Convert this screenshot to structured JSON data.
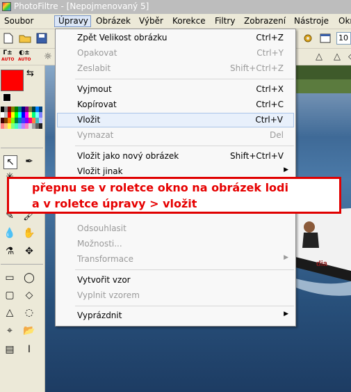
{
  "window": {
    "title": "PhotoFiltre - [Nepojmenovaný 5]"
  },
  "menubar": {
    "items": [
      {
        "label": "Soubor"
      },
      {
        "label": "Úpravy"
      },
      {
        "label": "Obrázek"
      },
      {
        "label": "Výběr"
      },
      {
        "label": "Korekce"
      },
      {
        "label": "Filtry"
      },
      {
        "label": "Zobrazení"
      },
      {
        "label": "Nástroje"
      },
      {
        "label": "Okr"
      }
    ]
  },
  "toolbar": {
    "zoom_value": "10",
    "auto1": "AUTO",
    "auto2": "AUTO"
  },
  "edit_menu": {
    "items": [
      {
        "label": "Zpět Velikost obrázku",
        "shortcut": "Ctrl+Z",
        "enabled": true
      },
      {
        "label": "Opakovat",
        "shortcut": "Ctrl+Y",
        "enabled": false
      },
      {
        "label": "Zeslabit",
        "shortcut": "Shift+Ctrl+Z",
        "enabled": false
      },
      {
        "label": "Vyjmout",
        "shortcut": "Ctrl+X",
        "enabled": true
      },
      {
        "label": "Kopírovat",
        "shortcut": "Ctrl+C",
        "enabled": true
      },
      {
        "label": "Vložit",
        "shortcut": "Ctrl+V",
        "enabled": true,
        "highlighted": true
      },
      {
        "label": "Vymazat",
        "shortcut": "Del",
        "enabled": false
      },
      {
        "label": "Vložit jako nový obrázek",
        "shortcut": "Shift+Ctrl+V",
        "enabled": true
      },
      {
        "label": "Vložit jinak",
        "shortcut": "",
        "enabled": true,
        "submenu": true
      },
      {
        "label": "Odsouhlasit",
        "shortcut": "",
        "enabled": false
      },
      {
        "label": "Možnosti...",
        "shortcut": "",
        "enabled": false
      },
      {
        "label": "Transformace",
        "shortcut": "",
        "enabled": false,
        "submenu": true
      },
      {
        "label": "Vytvořit vzor",
        "shortcut": "",
        "enabled": true
      },
      {
        "label": "Vyplnit vzorem",
        "shortcut": "",
        "enabled": false
      },
      {
        "label": "Vyprázdnit",
        "shortcut": "",
        "enabled": true,
        "submenu": true
      }
    ]
  },
  "annotation": {
    "line1": "přepnu se v roletce okno na obrázek lodi",
    "line2": "a v roletce úpravy > vložit"
  },
  "canvas": {
    "boat_text": "dia"
  },
  "colors": {
    "foreground": "#ff0000",
    "annotation_border": "#e00000",
    "annotation_text": "#e60000"
  },
  "palette_colors": [
    "#000000",
    "#808080",
    "#800000",
    "#808000",
    "#008000",
    "#008080",
    "#000080",
    "#800080",
    "#808040",
    "#004040",
    "#0080ff",
    "#004080",
    "#ffffff",
    "#c0c0c0",
    "#ff0000",
    "#ffff00",
    "#00ff00",
    "#00ffff",
    "#0000ff",
    "#ff00ff",
    "#ffff80",
    "#00ff80",
    "#80ffff",
    "#8080ff",
    "#400000",
    "#804000",
    "#ff8000",
    "#80ff00",
    "#008040",
    "#0080c0",
    "#4040ff",
    "#8000ff",
    "#ff0080",
    "#ff8040",
    "#40c0c0",
    "#c0c0ff",
    "#ff8080",
    "#ffc080",
    "#ffff40",
    "#80ff80",
    "#40ffc0",
    "#80c0ff",
    "#c080ff",
    "#ff80c0",
    "#e0e0e0",
    "#a0a0a0",
    "#606060",
    "#202020"
  ]
}
